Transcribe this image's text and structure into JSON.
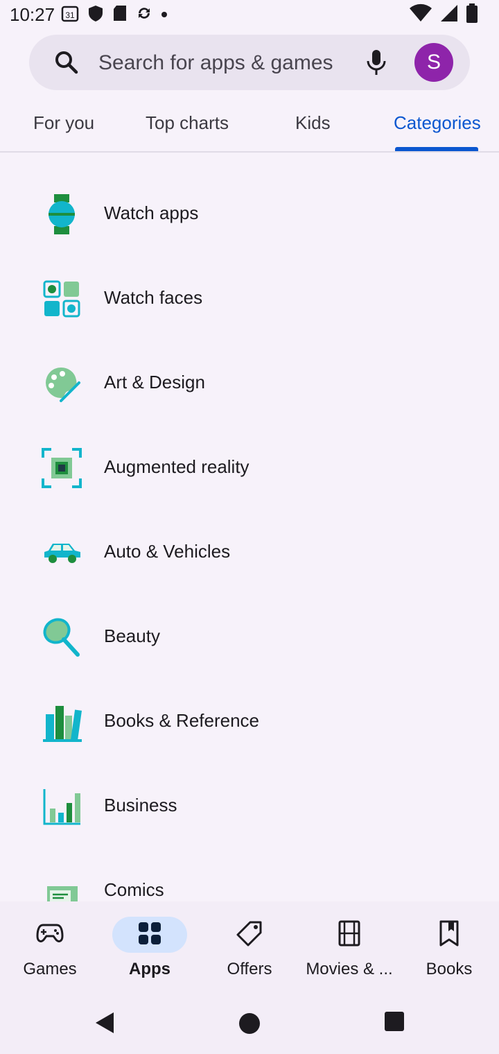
{
  "status_bar": {
    "time": "10:27",
    "calendar_badge": "31"
  },
  "search": {
    "placeholder": "Search for apps & games",
    "avatar_letter": "S"
  },
  "tabs": [
    {
      "label": "For you",
      "active": false
    },
    {
      "label": "Top charts",
      "active": false
    },
    {
      "label": "Kids",
      "active": false
    },
    {
      "label": "Categories",
      "active": true
    }
  ],
  "categories": [
    {
      "label": "Watch apps",
      "icon": "watch-icon"
    },
    {
      "label": "Watch faces",
      "icon": "watch-faces-icon"
    },
    {
      "label": "Art & Design",
      "icon": "palette-icon"
    },
    {
      "label": "Augmented reality",
      "icon": "augmented-reality-icon"
    },
    {
      "label": "Auto & Vehicles",
      "icon": "car-icon"
    },
    {
      "label": "Beauty",
      "icon": "mirror-icon"
    },
    {
      "label": "Books & Reference",
      "icon": "books-icon"
    },
    {
      "label": "Business",
      "icon": "bar-chart-icon"
    },
    {
      "label": "Comics",
      "icon": "comics-icon"
    }
  ],
  "bottom_nav": [
    {
      "label": "Games",
      "icon": "gamepad-icon",
      "active": false
    },
    {
      "label": "Apps",
      "icon": "apps-icon",
      "active": true
    },
    {
      "label": "Offers",
      "icon": "tag-icon",
      "active": false
    },
    {
      "label": "Movies & ...",
      "icon": "film-icon",
      "active": false
    },
    {
      "label": "Books",
      "icon": "bookmark-icon",
      "active": false
    }
  ],
  "colors": {
    "accent": "#0b57d0",
    "avatar": "#8e24aa",
    "active_nav_pill": "#d3e3fd"
  }
}
